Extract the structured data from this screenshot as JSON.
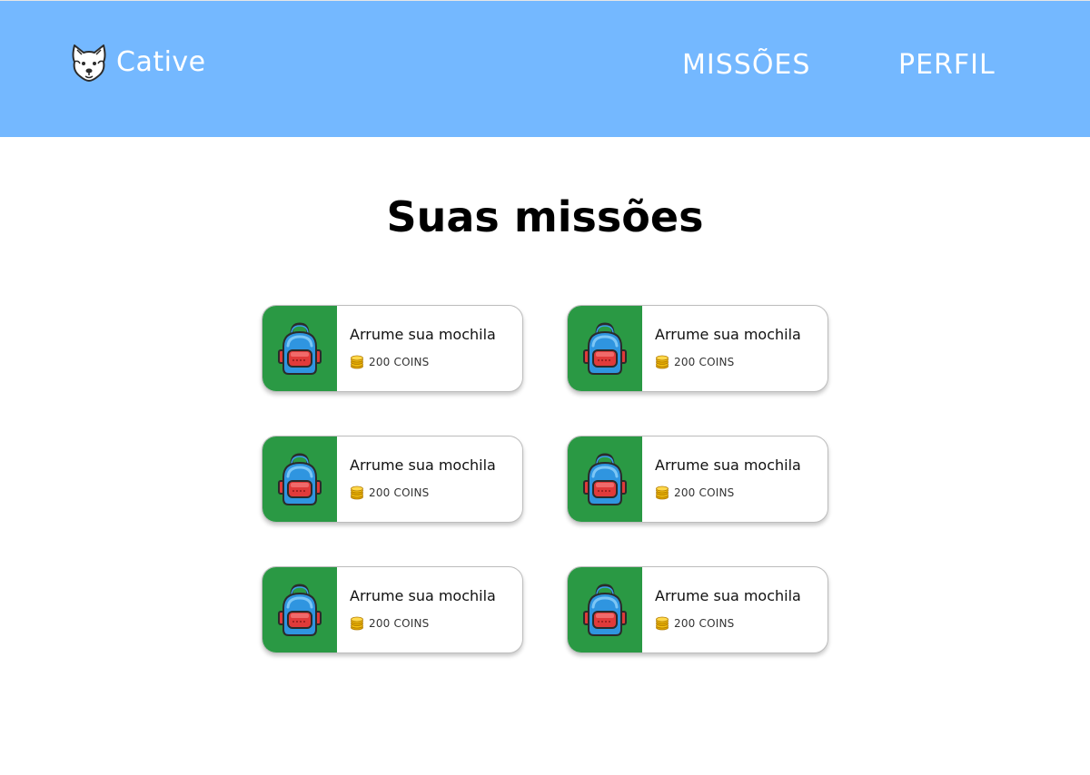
{
  "header": {
    "brand": "Cative",
    "logo_icon": "dog-icon",
    "nav": {
      "missions": "MISSÕES",
      "profile": "PERFIL"
    },
    "background_color": "#74b8ff"
  },
  "page": {
    "title": "Suas missões"
  },
  "missions": [
    {
      "title": "Arrume sua mochila",
      "reward": "200 COINS",
      "icon": "backpack-icon"
    },
    {
      "title": "Arrume sua mochila",
      "reward": "200 COINS",
      "icon": "backpack-icon"
    },
    {
      "title": "Arrume sua mochila",
      "reward": "200 COINS",
      "icon": "backpack-icon"
    },
    {
      "title": "Arrume sua mochila",
      "reward": "200 COINS",
      "icon": "backpack-icon"
    },
    {
      "title": "Arrume sua mochila",
      "reward": "200 COINS",
      "icon": "backpack-icon"
    },
    {
      "title": "Arrume sua mochila",
      "reward": "200 COINS",
      "icon": "backpack-icon"
    }
  ],
  "colors": {
    "card_accent": "#2a9944",
    "coin": "#f5c211"
  }
}
